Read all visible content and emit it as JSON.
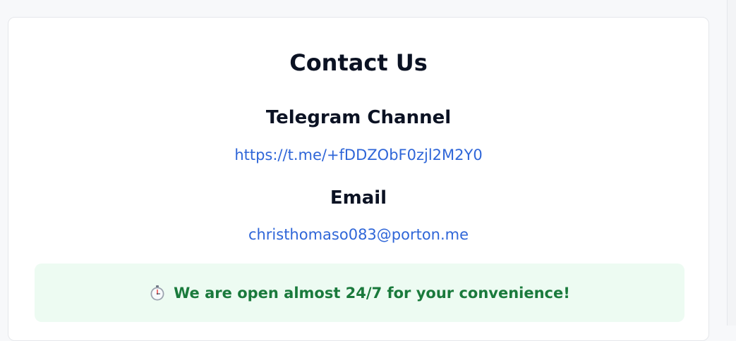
{
  "page": {
    "title": "Contact Us"
  },
  "telegram": {
    "heading": "Telegram Channel",
    "url": "https://t.me/+fDDZObF0zjl2M2Y0"
  },
  "email": {
    "heading": "Email",
    "address": "christhomaso083@porton.me"
  },
  "notice": {
    "icon": "stopwatch-icon",
    "text": "We are open almost 24/7 for your convenience!"
  },
  "colors": {
    "link": "#2f66d8",
    "notice_background": "#edfbf2",
    "notice_text": "#1a7a3c",
    "heading": "#0b1223"
  }
}
